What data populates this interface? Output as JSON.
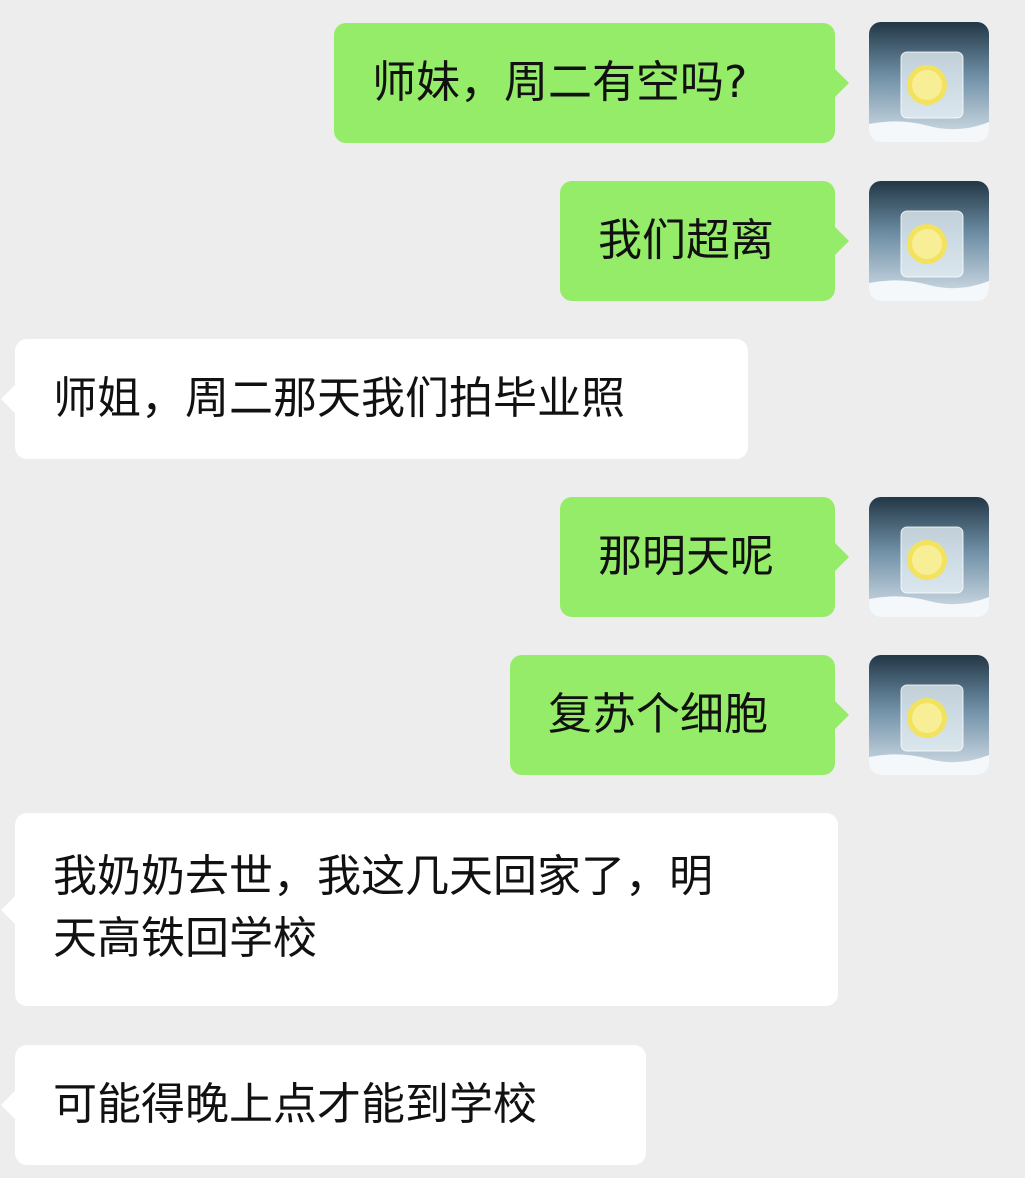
{
  "chat": {
    "messages": [
      {
        "side": "sent",
        "text": "师妹，周二有空吗?"
      },
      {
        "side": "sent",
        "text": "我们超离"
      },
      {
        "side": "received",
        "text": "师姐，周二那天我们拍毕业照"
      },
      {
        "side": "sent",
        "text": "那明天呢"
      },
      {
        "side": "sent",
        "text": "复苏个细胞"
      },
      {
        "side": "received",
        "text": "我奶奶去世，我这几天回家了，明\n天高铁回学校"
      },
      {
        "side": "received",
        "text": "可能得晚上点才能到学校"
      }
    ],
    "my_avatar": {
      "icon": "ice-cube-lemon-avatar-icon"
    }
  },
  "colors": {
    "background": "#ededed",
    "sent_bubble": "#95ec69",
    "received_bubble": "#ffffff",
    "text": "#111111"
  }
}
